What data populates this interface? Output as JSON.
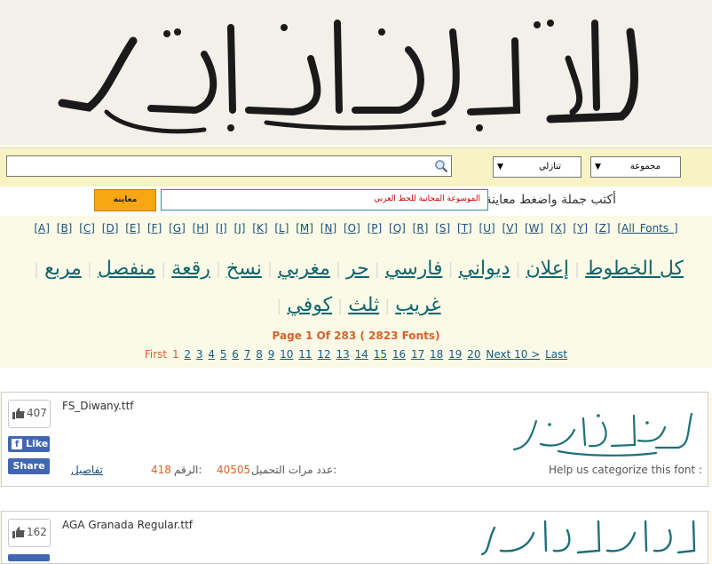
{
  "search": {
    "value": "",
    "placeholder": ""
  },
  "filters": {
    "sort_value": "تنازلي",
    "group_value": "مجموعة"
  },
  "preview": {
    "label": "أكتب جملة واضغط معاينة",
    "input_value": "الموسوعة المجانية للخط العربي",
    "button_label": "معاينة"
  },
  "alphabet": [
    "[A]",
    "[B]",
    "[C]",
    "[D]",
    "[E]",
    "[F]",
    "[G]",
    "[H]",
    "[I]",
    "[J]",
    "[K]",
    "[L]",
    "[M]",
    "[N]",
    "[O]",
    "[P]",
    "[Q]",
    "[R]",
    "[S]",
    "[T]",
    "[U]",
    "[V]",
    "[W]",
    "[X]",
    "[Y]",
    "[Z]",
    "[All Fonts ]"
  ],
  "categories": [
    "كل الخطوط",
    "إعلان",
    "ديواني",
    "فارسي",
    "حر",
    "مغربي",
    "نسخ",
    "رقعة",
    "منفصل",
    "مربع",
    "غريب",
    "ثلث",
    "كوفي"
  ],
  "pagination": {
    "info": "Page 1 Of 283 ( 2823 Fonts)",
    "first": "First",
    "current": "1",
    "pages": [
      "2",
      "3",
      "4",
      "5",
      "6",
      "7",
      "8",
      "9",
      "10",
      "11",
      "12",
      "13",
      "14",
      "15",
      "16",
      "17",
      "18",
      "19",
      "20"
    ],
    "next": "Next 10 >",
    "last": "Last"
  },
  "fonts": [
    {
      "likes": "407",
      "like_label": "Like",
      "share_label": "Share",
      "filename": "FS_Diwany.ttf",
      "details_label": "تفاصيل",
      "number_label": "الرقم:",
      "number_value": "418",
      "downloads_label": "عدد مرات التحميل:",
      "downloads_value": "40505",
      "help_text": "Help us categorize this font :",
      "sample_text": "الموسوعة المجانية للخط العربي"
    },
    {
      "likes": "162",
      "filename": "AGA Granada Regular.ttf",
      "sample_text": "الموسوعة المجانية للخط العربي"
    }
  ],
  "colors": {
    "accent_orange": "#f7a614",
    "link_teal": "#10646e",
    "pager_orange": "#d8622d",
    "facebook_blue": "#4267b2"
  }
}
